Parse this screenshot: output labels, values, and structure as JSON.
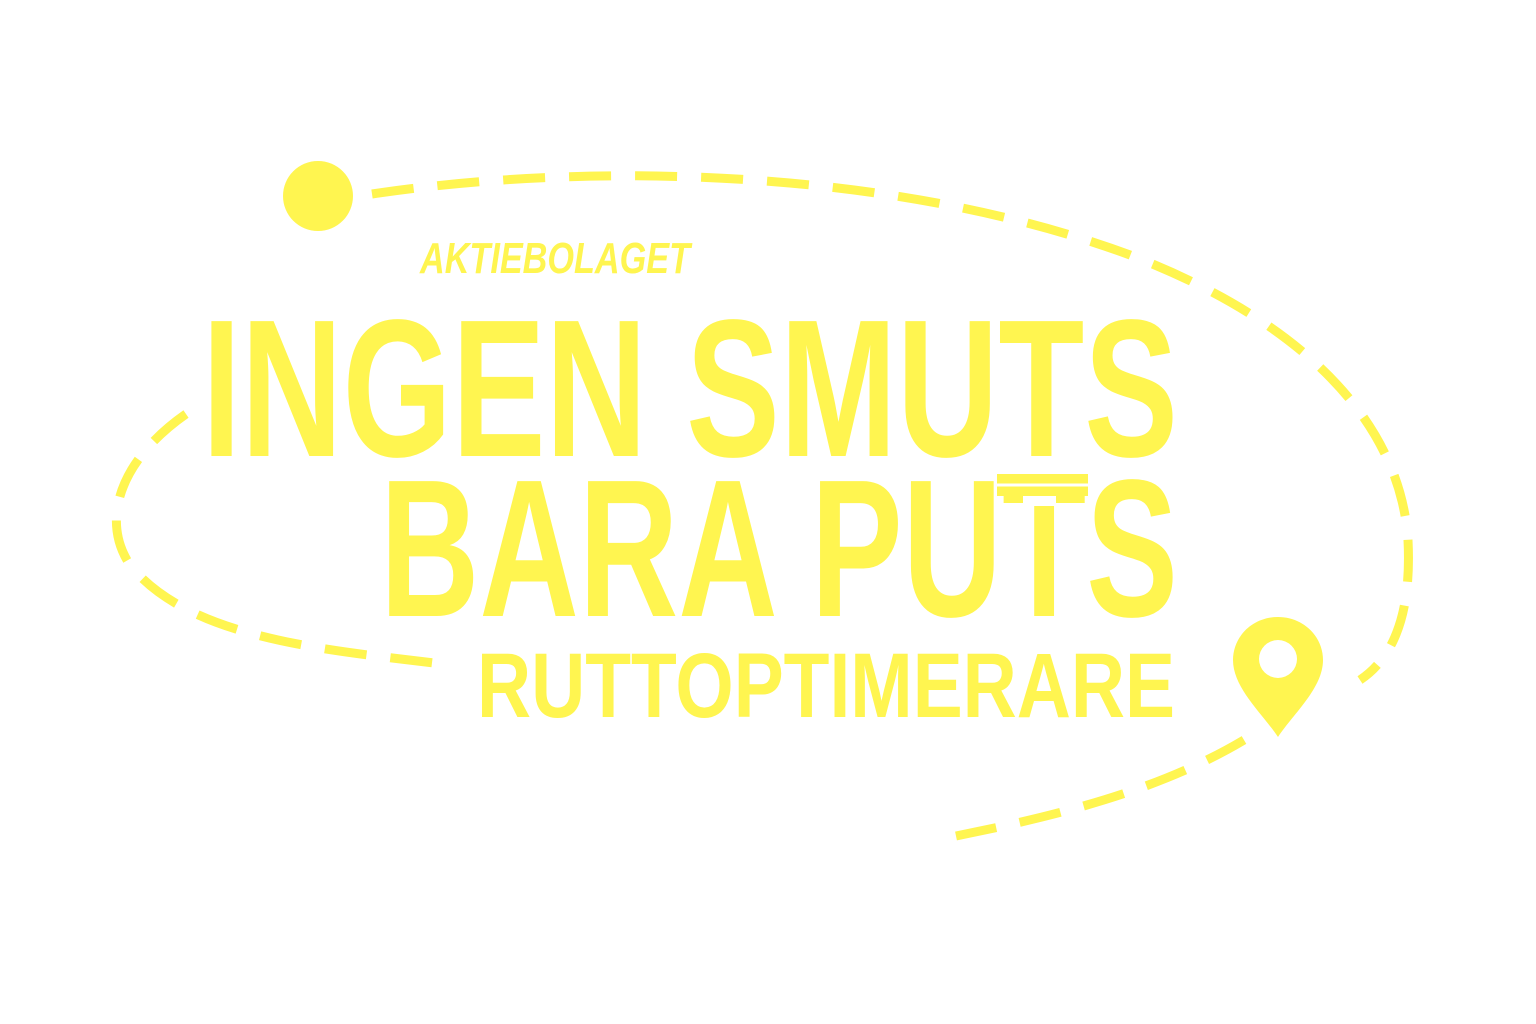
{
  "logo": {
    "prefix": "AKTIEBOLAGET",
    "line1": "INGEN SMUTS",
    "line2": "BARA PUTS",
    "tagline": "RUTTOPTIMERARE"
  },
  "colors": {
    "brand_yellow": "#fff550",
    "background": "#ffffff"
  },
  "icons": [
    "route-start-dot-icon",
    "map-pin-icon",
    "squeegee-icon"
  ]
}
